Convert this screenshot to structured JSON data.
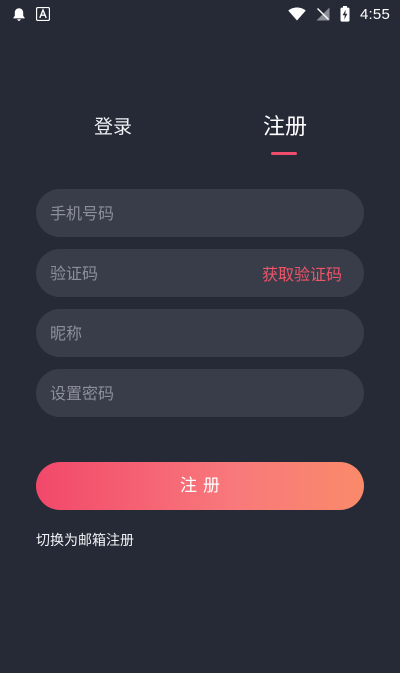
{
  "status_bar": {
    "time": "4:55",
    "left_icons": [
      "notification-bell-icon",
      "font-a-icon"
    ],
    "right_icons": [
      "wifi-icon",
      "signal-off-icon",
      "battery-charging-icon"
    ]
  },
  "tabs": {
    "login_label": "登录",
    "register_label": "注册",
    "active": "register"
  },
  "form": {
    "phone_placeholder": "手机号码",
    "code_placeholder": "验证码",
    "get_code_label": "获取验证码",
    "nickname_placeholder": "昵称",
    "password_placeholder": "设置密码",
    "phone_value": "",
    "code_value": "",
    "nickname_value": "",
    "password_value": ""
  },
  "submit_label": "注册",
  "switch_link": "切换为邮箱注册",
  "colors": {
    "background": "#262a36",
    "field": "#393d4a",
    "accent": "#ef4d6b",
    "gradient_start": "#f2486a",
    "gradient_end": "#fa8a6a"
  }
}
